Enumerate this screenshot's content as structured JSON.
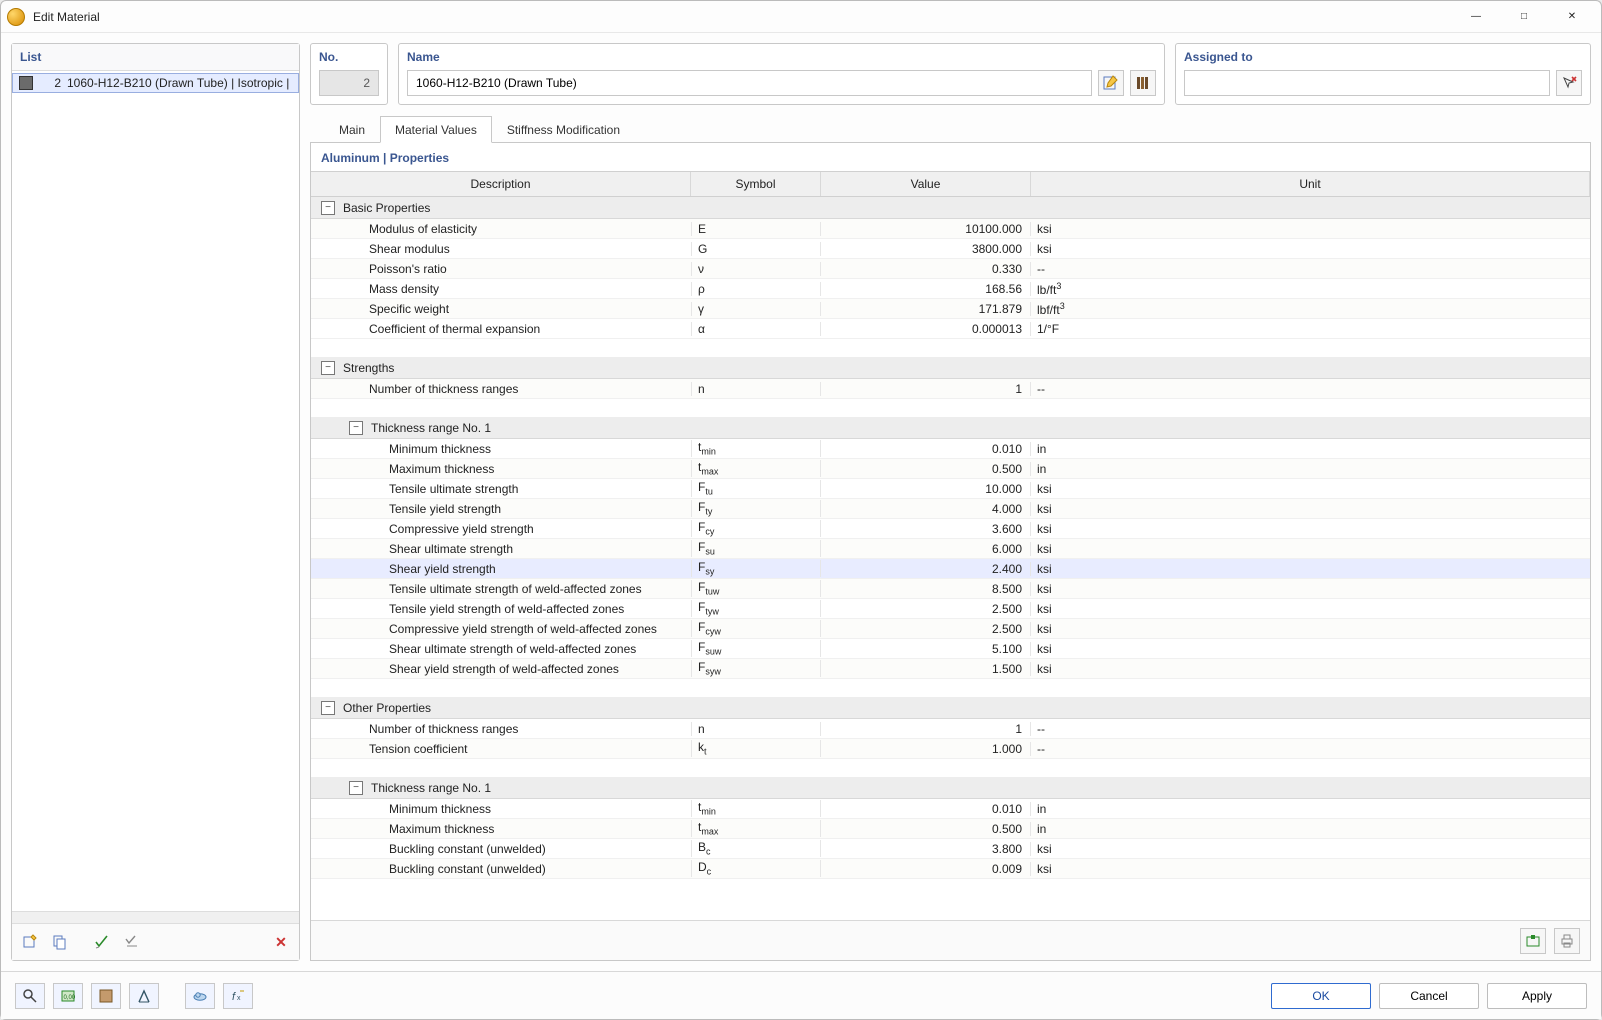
{
  "window": {
    "title": "Edit Material"
  },
  "left": {
    "header": "List",
    "item": {
      "num": "2",
      "label": "1060-H12-B210 (Drawn Tube) | Isotropic |"
    }
  },
  "fields": {
    "no_label": "No.",
    "no_value": "2",
    "name_label": "Name",
    "name_value": "1060-H12-B210 (Drawn Tube)",
    "assigned_label": "Assigned to",
    "assigned_value": ""
  },
  "tabs": {
    "main": "Main",
    "mvals": "Material Values",
    "stiff": "Stiffness Modification"
  },
  "section_title": "Aluminum | Properties",
  "cols": {
    "desc": "Description",
    "sym": "Symbol",
    "val": "Value",
    "unit": "Unit"
  },
  "groups": {
    "basic": "Basic Properties",
    "strengths": "Strengths",
    "tr1": "Thickness range No. 1",
    "other": "Other Properties",
    "tr1b": "Thickness range No. 1"
  },
  "rows": {
    "E": {
      "d": "Modulus of elasticity",
      "s": "E",
      "v": "10100.000",
      "u": "ksi"
    },
    "G": {
      "d": "Shear modulus",
      "s": "G",
      "v": "3800.000",
      "u": "ksi"
    },
    "nu": {
      "d": "Poisson's ratio",
      "s": "ν",
      "v": "0.330",
      "u": "--"
    },
    "rho": {
      "d": "Mass density",
      "s": "ρ",
      "v": "168.56",
      "u": "lb/ft³"
    },
    "gam": {
      "d": "Specific weight",
      "s": "γ",
      "v": "171.879",
      "u": "lbf/ft³"
    },
    "alp": {
      "d": "Coefficient of thermal expansion",
      "s": "α",
      "v": "0.000013",
      "u": "1/°F"
    },
    "n": {
      "d": "Number of thickness ranges",
      "s": "n",
      "v": "1",
      "u": "--"
    },
    "tmin": {
      "d": "Minimum thickness",
      "s": "t",
      "ss": "min",
      "v": "0.010",
      "u": "in"
    },
    "tmax": {
      "d": "Maximum thickness",
      "s": "t",
      "ss": "max",
      "v": "0.500",
      "u": "in"
    },
    "Ftu": {
      "d": "Tensile ultimate strength",
      "s": "F",
      "ss": "tu",
      "v": "10.000",
      "u": "ksi"
    },
    "Fty": {
      "d": "Tensile yield strength",
      "s": "F",
      "ss": "ty",
      "v": "4.000",
      "u": "ksi"
    },
    "Fcy": {
      "d": "Compressive yield strength",
      "s": "F",
      "ss": "cy",
      "v": "3.600",
      "u": "ksi"
    },
    "Fsu": {
      "d": "Shear ultimate strength",
      "s": "F",
      "ss": "su",
      "v": "6.000",
      "u": "ksi"
    },
    "Fsy": {
      "d": "Shear yield strength",
      "s": "F",
      "ss": "sy",
      "v": "2.400",
      "u": "ksi"
    },
    "Ftuw": {
      "d": "Tensile ultimate strength of weld-affected zones",
      "s": "F",
      "ss": "tuw",
      "v": "8.500",
      "u": "ksi"
    },
    "Ftyw": {
      "d": "Tensile yield strength of weld-affected zones",
      "s": "F",
      "ss": "tyw",
      "v": "2.500",
      "u": "ksi"
    },
    "Fcyw": {
      "d": "Compressive yield strength of weld-affected zones",
      "s": "F",
      "ss": "cyw",
      "v": "2.500",
      "u": "ksi"
    },
    "Fsuw": {
      "d": "Shear ultimate strength of weld-affected zones",
      "s": "F",
      "ss": "suw",
      "v": "5.100",
      "u": "ksi"
    },
    "Fsyw": {
      "d": "Shear yield strength of weld-affected zones",
      "s": "F",
      "ss": "syw",
      "v": "1.500",
      "u": "ksi"
    },
    "n2": {
      "d": "Number of thickness ranges",
      "s": "n",
      "v": "1",
      "u": "--"
    },
    "kt": {
      "d": "Tension coefficient",
      "s": "k",
      "ss": "t",
      "v": "1.000",
      "u": "--"
    },
    "tmin2": {
      "d": "Minimum thickness",
      "s": "t",
      "ss": "min",
      "v": "0.010",
      "u": "in"
    },
    "tmax2": {
      "d": "Maximum thickness",
      "s": "t",
      "ss": "max",
      "v": "0.500",
      "u": "in"
    },
    "Bc": {
      "d": "Buckling constant (unwelded)",
      "s": "B",
      "ss": "c",
      "v": "3.800",
      "u": "ksi"
    },
    "Dc": {
      "d": "Buckling constant (unwelded)",
      "s": "D",
      "ss": "c",
      "v": "0.009",
      "u": "ksi"
    }
  },
  "buttons": {
    "ok": "OK",
    "cancel": "Cancel",
    "apply": "Apply"
  }
}
